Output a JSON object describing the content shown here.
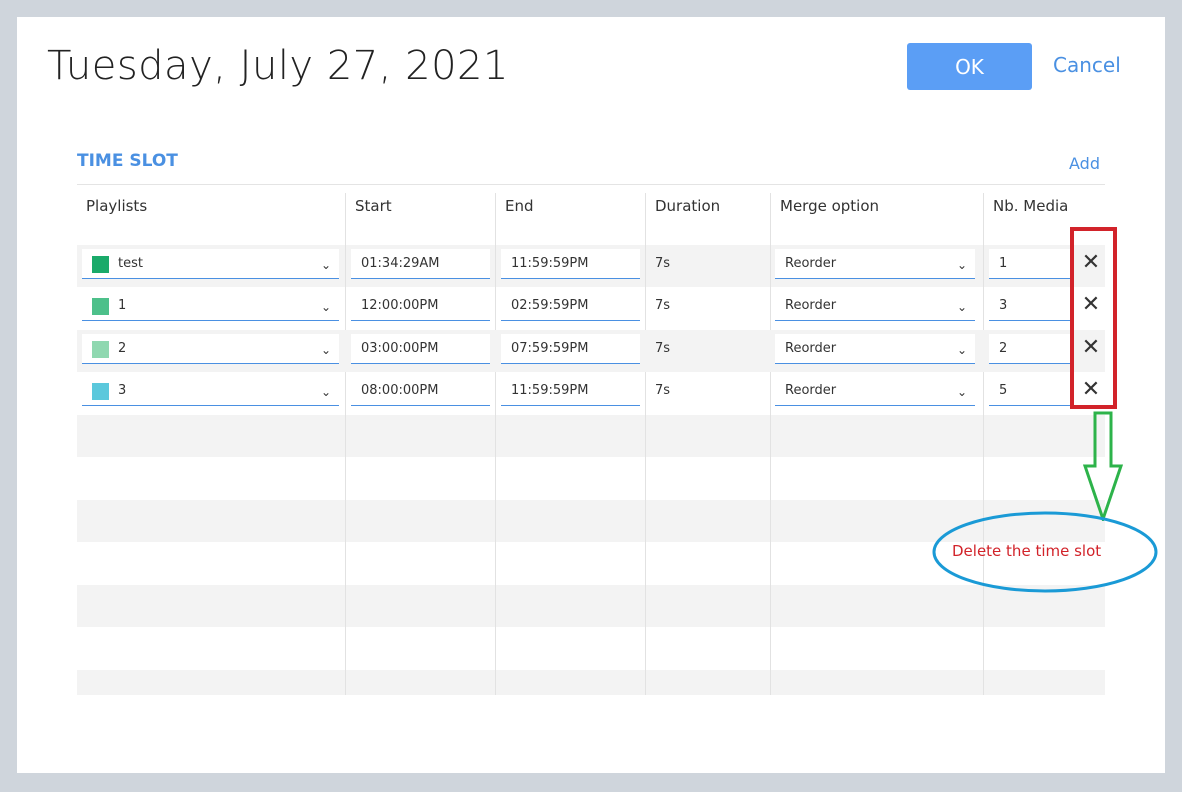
{
  "dialog": {
    "title": "Tuesday, July 27, 2021",
    "ok_label": "OK",
    "cancel_label": "Cancel"
  },
  "section": {
    "title": "TIME SLOT",
    "add_label": "Add"
  },
  "table": {
    "headers": [
      "Playlists",
      "Start",
      "End",
      "Duration",
      "Merge option",
      "Nb. Media"
    ],
    "rows": [
      {
        "playlist": "test",
        "color": "#1aaa6a",
        "start": "01:34:29AM",
        "end": "11:59:59PM",
        "duration": "7s",
        "merge": "Reorder",
        "media": "1"
      },
      {
        "playlist": "1",
        "color": "#4dc08a",
        "start": "12:00:00PM",
        "end": "02:59:59PM",
        "duration": "7s",
        "merge": "Reorder",
        "media": "3"
      },
      {
        "playlist": "2",
        "color": "#8fd8b0",
        "start": "03:00:00PM",
        "end": "07:59:59PM",
        "duration": "7s",
        "merge": "Reorder",
        "media": "2"
      },
      {
        "playlist": "3",
        "color": "#5bc8dc",
        "start": "08:00:00PM",
        "end": "11:59:59PM",
        "duration": "7s",
        "merge": "Reorder",
        "media": "5"
      }
    ]
  },
  "annotation": {
    "text": "Delete the time slot",
    "box_color": "#d2232a",
    "arrow_color": "#2db34a",
    "ellipse_color": "#1a9ad6"
  },
  "colors": {
    "accent": "#4a90e2",
    "ok_button": "#5b9ef5"
  }
}
